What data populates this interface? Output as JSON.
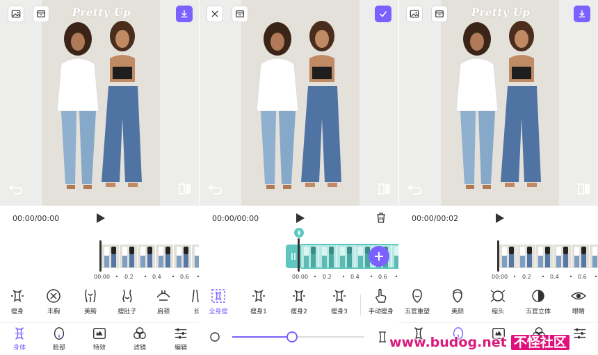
{
  "colors": {
    "accent": "#7b61ff",
    "teal": "#5fc7c0",
    "icon": "#333333",
    "magenta_logo": "#e0117a"
  },
  "photo": {
    "watermark": "Pretty Up"
  },
  "panel1": {
    "time": "00:00/00:00",
    "ticks": [
      "00:00",
      "•",
      "0.2",
      "•",
      "0.4",
      "•",
      "0.6",
      "•"
    ],
    "tools": [
      {
        "label": "瘦身",
        "icon": "waist-slim-icon"
      },
      {
        "label": "丰胸",
        "icon": "chest-arrows-icon"
      },
      {
        "label": "美胯",
        "icon": "hip-icon"
      },
      {
        "label": "瘦肚子",
        "icon": "belly-icon"
      },
      {
        "label": "肩颈",
        "icon": "shoulder-icon"
      },
      {
        "label": "长",
        "icon": "leg-length-icon"
      }
    ],
    "tabs": [
      {
        "label": "身体",
        "icon": "body-icon"
      },
      {
        "label": "脸部",
        "icon": "face-icon"
      },
      {
        "label": "特效",
        "icon": "effects-icon"
      },
      {
        "label": "滤镜",
        "icon": "filter-icon"
      },
      {
        "label": "编辑",
        "icon": "edit-sliders-icon"
      }
    ]
  },
  "panel2": {
    "time": "00:00/00:00",
    "ticks": [
      "00:00",
      "•",
      "0.2",
      "•",
      "0.4",
      "•",
      "0.6",
      "•"
    ],
    "tools": [
      {
        "label": "全身瘦",
        "icon": "full-body-icon"
      },
      {
        "label": "瘦身1",
        "icon": "waist-slim-1-icon"
      },
      {
        "label": "瘦身2",
        "icon": "waist-slim-2-icon"
      },
      {
        "label": "瘦身3",
        "icon": "waist-slim-3-icon"
      },
      {
        "label": "手动瘦身",
        "icon": "hand-pointer-icon"
      }
    ],
    "slider_value": 0.45
  },
  "panel3": {
    "time": "00:00/00:02",
    "ticks": [
      "00:00",
      "•",
      "0.2",
      "•",
      "0.4",
      "•",
      "0.6",
      "•"
    ],
    "tools": [
      {
        "label": "五官重塑",
        "icon": "face-reshape-icon"
      },
      {
        "label": "美颜",
        "icon": "beauty-face-icon"
      },
      {
        "label": "缩头",
        "icon": "head-shrink-icon"
      },
      {
        "label": "五官立体",
        "icon": "contour-icon"
      },
      {
        "label": "眼睛",
        "icon": "eye-icon"
      }
    ]
  },
  "logo": {
    "url": "www.budog.net",
    "cn": "不怪社区"
  }
}
